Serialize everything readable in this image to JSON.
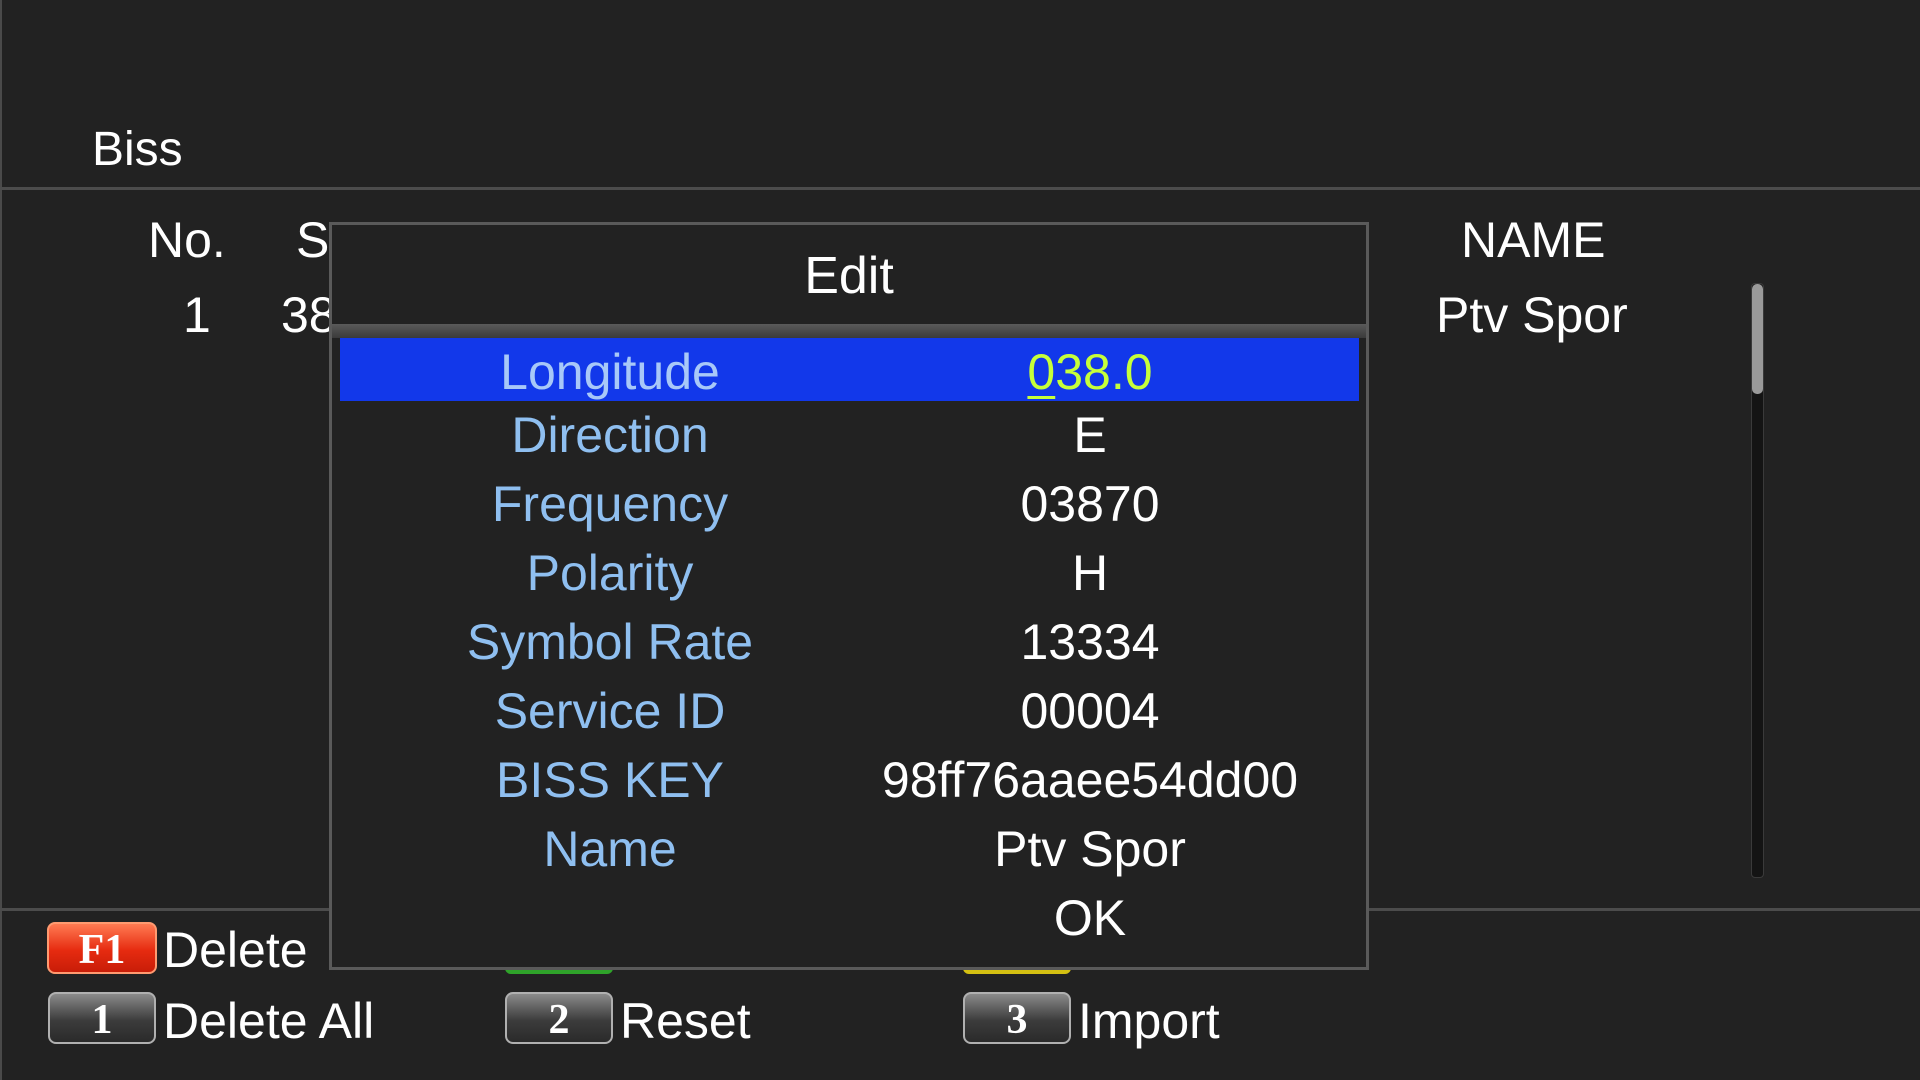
{
  "screen": {
    "title": "Biss"
  },
  "table": {
    "headers": {
      "no": "No.",
      "sat": "S",
      "name": "NAME"
    },
    "rows": [
      {
        "no": "1",
        "sat": "38",
        "name": "Ptv Spor"
      }
    ]
  },
  "dialog": {
    "title": "Edit",
    "fields": [
      {
        "label": "Longitude",
        "value_cursor": "0",
        "value_rest": "38.0",
        "selected": true
      },
      {
        "label": "Direction",
        "value": "E"
      },
      {
        "label": "Frequency",
        "value": "03870"
      },
      {
        "label": "Polarity",
        "value": "H"
      },
      {
        "label": "Symbol Rate",
        "value": "13334"
      },
      {
        "label": "Service ID",
        "value": "00004"
      },
      {
        "label": "BISS KEY",
        "value": "98ff76aaee54dd00"
      },
      {
        "label": "Name",
        "value": "Ptv Spor"
      }
    ],
    "ok_label": "OK"
  },
  "footer": {
    "f1": {
      "key": "F1",
      "label": "Delete"
    },
    "k1": {
      "key": "1",
      "label": "Delete All"
    },
    "k2": {
      "key": "2",
      "label": "Reset"
    },
    "k3": {
      "key": "3",
      "label": "Import"
    }
  },
  "colors": {
    "background": "#222222",
    "selection": "#1238ea",
    "label": "#8fbff0",
    "selected_value": "#c6ff3a",
    "red_key": "#e62b10"
  }
}
